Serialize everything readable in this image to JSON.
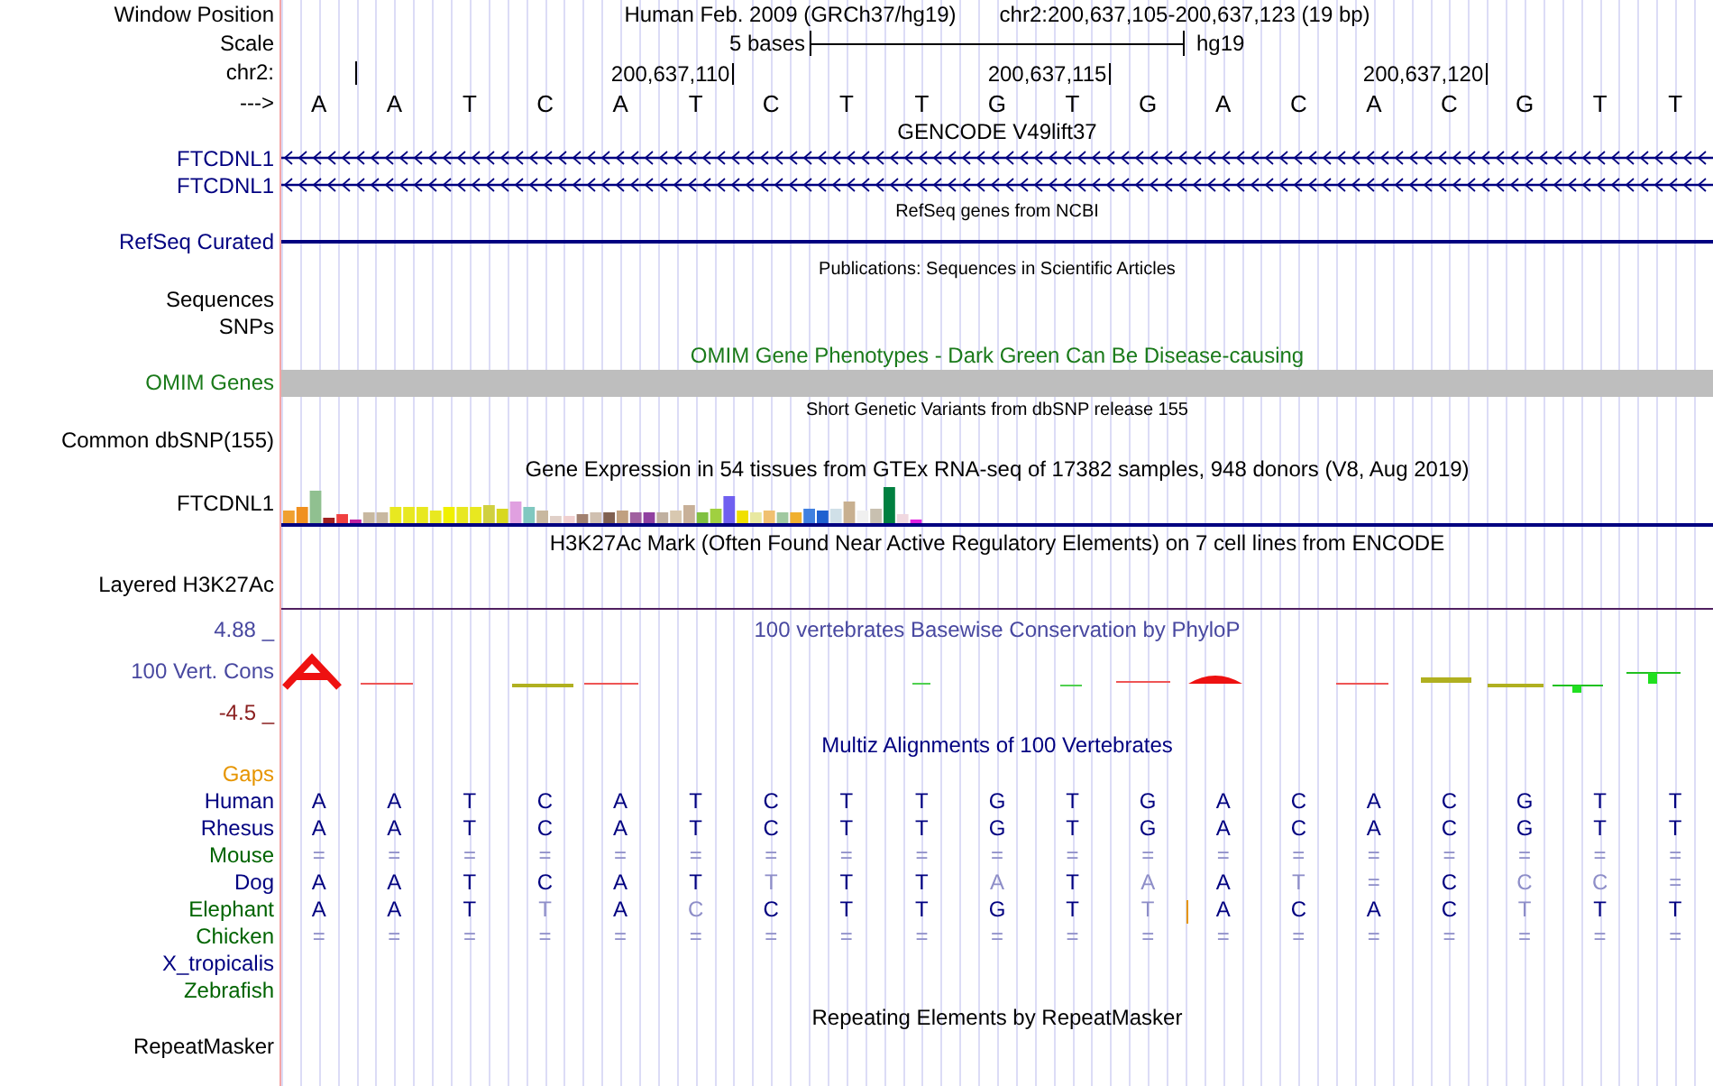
{
  "header": {
    "label": "Window Position",
    "assembly": "Human Feb. 2009 (GRCh37/hg19)",
    "position": "chr2:200,637,105-200,637,123 (19 bp)"
  },
  "scale": {
    "label": "Scale",
    "span": "5 bases",
    "assembly": "hg19"
  },
  "ruler": {
    "label": "chr2:",
    "ticks": [
      "200,637,110",
      "200,637,115",
      "200,637,120"
    ]
  },
  "strand": {
    "label": "--->",
    "bases": [
      "A",
      "A",
      "T",
      "C",
      "A",
      "T",
      "C",
      "T",
      "T",
      "G",
      "T",
      "G",
      "A",
      "C",
      "A",
      "C",
      "G",
      "T",
      "T"
    ]
  },
  "tracks": [
    {
      "kind": "gene",
      "title": "GENCODE V49lift37",
      "genes": [
        {
          "label": "FTCDNL1"
        },
        {
          "label": "FTCDNL1"
        }
      ]
    },
    {
      "kind": "refseq",
      "title": "RefSeq genes from NCBI",
      "label": "RefSeq Curated"
    },
    {
      "kind": "labels",
      "compact": true,
      "title": "Publications: Sequences in Scientific Articles",
      "labels": [
        "Sequences",
        "SNPs"
      ]
    },
    {
      "kind": "omim",
      "title": "OMIM Gene Phenotypes - Dark Green Can Be Disease-causing",
      "label": "OMIM Genes"
    },
    {
      "kind": "labels",
      "compact": true,
      "title": "Short Genetic Variants from dbSNP release 155",
      "labels": [
        "Common dbSNP(155)"
      ]
    },
    {
      "kind": "expression",
      "title": "Gene Expression in 54 tissues from GTEx RNA-seq of 17382 samples, 948 donors (V8, Aug 2019)",
      "label": "FTCDNL1"
    },
    {
      "kind": "layered",
      "title": "H3K27Ac Mark (Often Found Near Active Regulatory Elements) on 7 cell lines from ENCODE",
      "label": "Layered H3K27Ac"
    },
    {
      "kind": "conservation",
      "title": "100 vertebrates Basewise Conservation by PhyloP",
      "label": "100 Vert. Cons",
      "max": "4.88 _",
      "min": "-4.5 _"
    },
    {
      "kind": "alignment",
      "title": "Multiz Alignments of 100 Vertebrates",
      "species": [
        {
          "name": "Gaps",
          "color": "#e69500"
        },
        {
          "name": "Human",
          "color": "#000080",
          "bases": [
            {
              "b": "A",
              "faded": false
            },
            {
              "b": "A",
              "faded": false
            },
            {
              "b": "T",
              "faded": false
            },
            {
              "b": "C",
              "faded": false
            },
            {
              "b": "A",
              "faded": false
            },
            {
              "b": "T",
              "faded": false
            },
            {
              "b": "C",
              "faded": false
            },
            {
              "b": "T",
              "faded": false
            },
            {
              "b": "T",
              "faded": false
            },
            {
              "b": "G",
              "faded": false
            },
            {
              "b": "T",
              "faded": false
            },
            {
              "b": "G",
              "faded": false
            },
            {
              "b": "A",
              "faded": false
            },
            {
              "b": "C",
              "faded": false
            },
            {
              "b": "A",
              "faded": false
            },
            {
              "b": "C",
              "faded": false
            },
            {
              "b": "G",
              "faded": false
            },
            {
              "b": "T",
              "faded": false
            },
            {
              "b": "T",
              "faded": false
            }
          ]
        },
        {
          "name": "Rhesus",
          "color": "#000080",
          "bases": [
            {
              "b": "A",
              "faded": false
            },
            {
              "b": "A",
              "faded": false
            },
            {
              "b": "T",
              "faded": false
            },
            {
              "b": "C",
              "faded": false
            },
            {
              "b": "A",
              "faded": false
            },
            {
              "b": "T",
              "faded": false
            },
            {
              "b": "C",
              "faded": false
            },
            {
              "b": "T",
              "faded": false
            },
            {
              "b": "T",
              "faded": false
            },
            {
              "b": "G",
              "faded": false
            },
            {
              "b": "T",
              "faded": false
            },
            {
              "b": "G",
              "faded": false
            },
            {
              "b": "A",
              "faded": false
            },
            {
              "b": "C",
              "faded": false
            },
            {
              "b": "A",
              "faded": false
            },
            {
              "b": "C",
              "faded": false
            },
            {
              "b": "G",
              "faded": false
            },
            {
              "b": "T",
              "faded": false
            },
            {
              "b": "T",
              "faded": false
            }
          ]
        },
        {
          "name": "Mouse",
          "color": "#006400",
          "bases": [
            {
              "b": "=",
              "faded": true
            },
            {
              "b": "=",
              "faded": true
            },
            {
              "b": "=",
              "faded": true
            },
            {
              "b": "=",
              "faded": true
            },
            {
              "b": "=",
              "faded": true
            },
            {
              "b": "=",
              "faded": true
            },
            {
              "b": "=",
              "faded": true
            },
            {
              "b": "=",
              "faded": true
            },
            {
              "b": "=",
              "faded": true
            },
            {
              "b": "=",
              "faded": true
            },
            {
              "b": "=",
              "faded": true
            },
            {
              "b": "=",
              "faded": true
            },
            {
              "b": "=",
              "faded": true
            },
            {
              "b": "=",
              "faded": true
            },
            {
              "b": "=",
              "faded": true
            },
            {
              "b": "=",
              "faded": true
            },
            {
              "b": "=",
              "faded": true
            },
            {
              "b": "=",
              "faded": true
            },
            {
              "b": "=",
              "faded": true
            }
          ]
        },
        {
          "name": "Dog",
          "color": "#000080",
          "bases": [
            {
              "b": "A",
              "faded": false
            },
            {
              "b": "A",
              "faded": false
            },
            {
              "b": "T",
              "faded": false
            },
            {
              "b": "C",
              "faded": false
            },
            {
              "b": "A",
              "faded": false
            },
            {
              "b": "T",
              "faded": false
            },
            {
              "b": "T",
              "faded": true
            },
            {
              "b": "T",
              "faded": false
            },
            {
              "b": "T",
              "faded": false
            },
            {
              "b": "A",
              "faded": true
            },
            {
              "b": "T",
              "faded": false
            },
            {
              "b": "A",
              "faded": true
            },
            {
              "b": "A",
              "faded": false
            },
            {
              "b": "T",
              "faded": true
            },
            {
              "b": "=",
              "faded": true
            },
            {
              "b": "C",
              "faded": false
            },
            {
              "b": "C",
              "faded": true
            },
            {
              "b": "C",
              "faded": true
            },
            {
              "b": "=",
              "faded": true
            }
          ]
        },
        {
          "name": "Elephant",
          "color": "#006400",
          "bases": [
            {
              "b": "A",
              "faded": false,
              "insertion": false
            },
            {
              "b": "A",
              "faded": false,
              "insertion": false
            },
            {
              "b": "T",
              "faded": false,
              "insertion": false
            },
            {
              "b": "T",
              "faded": true,
              "insertion": false
            },
            {
              "b": "A",
              "faded": false,
              "insertion": false
            },
            {
              "b": "C",
              "faded": true,
              "insertion": false
            },
            {
              "b": "C",
              "faded": false,
              "insertion": false
            },
            {
              "b": "T",
              "faded": false,
              "insertion": false
            },
            {
              "b": "T",
              "faded": false,
              "insertion": false
            },
            {
              "b": "G",
              "faded": false,
              "insertion": false
            },
            {
              "b": "T",
              "faded": false,
              "insertion": false
            },
            {
              "b": "T",
              "faded": true,
              "insertion": true
            },
            {
              "b": "A",
              "faded": false,
              "insertion": false
            },
            {
              "b": "C",
              "faded": false,
              "insertion": false
            },
            {
              "b": "A",
              "faded": false,
              "insertion": false
            },
            {
              "b": "C",
              "faded": false,
              "insertion": false
            },
            {
              "b": "T",
              "faded": true,
              "insertion": false
            },
            {
              "b": "T",
              "faded": false,
              "insertion": false
            },
            {
              "b": "T",
              "faded": false,
              "insertion": false
            }
          ]
        },
        {
          "name": "Chicken",
          "color": "#006400",
          "bases": [
            {
              "b": "=",
              "faded": true
            },
            {
              "b": "=",
              "faded": true
            },
            {
              "b": "=",
              "faded": true
            },
            {
              "b": "=",
              "faded": true
            },
            {
              "b": "=",
              "faded": true
            },
            {
              "b": "=",
              "faded": true
            },
            {
              "b": "=",
              "faded": true
            },
            {
              "b": "=",
              "faded": true
            },
            {
              "b": "=",
              "faded": true
            },
            {
              "b": "=",
              "faded": true
            },
            {
              "b": "=",
              "faded": true
            },
            {
              "b": "=",
              "faded": true
            },
            {
              "b": "=",
              "faded": true
            },
            {
              "b": "=",
              "faded": true
            },
            {
              "b": "=",
              "faded": true
            },
            {
              "b": "=",
              "faded": true
            },
            {
              "b": "=",
              "faded": true
            },
            {
              "b": "=",
              "faded": true
            },
            {
              "b": "=",
              "faded": true
            }
          ]
        },
        {
          "name": "X_tropicalis",
          "color": "#000080"
        },
        {
          "name": "Zebrafish",
          "color": "#006400"
        }
      ]
    },
    {
      "kind": "labels",
      "compact": false,
      "title": "Repeating Elements by RepeatMasker",
      "labels": [
        "RepeatMasker"
      ]
    }
  ]
}
